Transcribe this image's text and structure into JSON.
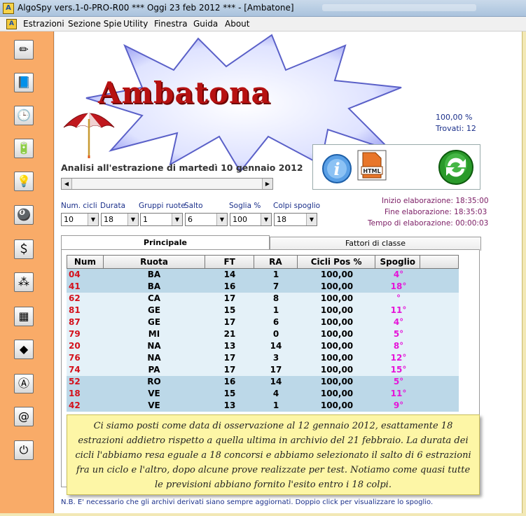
{
  "window": {
    "title": "AlgoSpy vers.1-0-PRO-R00  ***  Oggi 23 feb 2012  ***   - [Ambatone]"
  },
  "menu": [
    "Estrazioni",
    "Sezione Spie",
    "Utility",
    "Finestra",
    "Guida",
    "About"
  ],
  "sidebar_icons": [
    "pencil-icon",
    "book-icon",
    "clock-icon",
    "battery-icon",
    "bulb-icon",
    "lottery-icon",
    "dollar-icon",
    "molecule-icon",
    "calendar-icon",
    "diamond-icon",
    "letter-a-icon",
    "address-book-icon",
    "power-icon"
  ],
  "banner": {
    "title": "Ambatona"
  },
  "stats": {
    "percent": "100,00 %",
    "trovati": "Trovati: 12"
  },
  "analisi": "Analisi all'estrazione di martedì 10 gennaio 2012",
  "params": {
    "labels": [
      "Num. cicli",
      "Durata",
      "Gruppi ruote",
      "Salto",
      "Soglia %",
      "Colpi spoglio"
    ],
    "values": [
      "10",
      "18",
      "1",
      "6",
      "100",
      "18"
    ]
  },
  "elaborazione": {
    "inizio": "Inizio elaborazione: 18:35:00",
    "fine": "Fine elaborazione: 18:35:03",
    "tempo": "Tempo di elaborazione: 00:00:03"
  },
  "tabs": [
    "Principale",
    "Fattori di classe"
  ],
  "table": {
    "headers": [
      "Num",
      "Ruota",
      "FT",
      "RA",
      "Cicli Pos %",
      "Spoglio"
    ],
    "rows": [
      [
        "04",
        "BA",
        "14",
        "1",
        "100,00",
        "4°"
      ],
      [
        "41",
        "BA",
        "16",
        "7",
        "100,00",
        "18°"
      ],
      [
        "62",
        "CA",
        "17",
        "8",
        "100,00",
        "°"
      ],
      [
        "81",
        "GE",
        "15",
        "1",
        "100,00",
        "11°"
      ],
      [
        "87",
        "GE",
        "17",
        "6",
        "100,00",
        "4°"
      ],
      [
        "79",
        "MI",
        "21",
        "0",
        "100,00",
        "5°"
      ],
      [
        "20",
        "NA",
        "13",
        "14",
        "100,00",
        "8°"
      ],
      [
        "76",
        "NA",
        "17",
        "3",
        "100,00",
        "12°"
      ],
      [
        "74",
        "PA",
        "17",
        "17",
        "100,00",
        "15°"
      ],
      [
        "52",
        "RO",
        "16",
        "14",
        "100,00",
        "5°"
      ],
      [
        "18",
        "VE",
        "15",
        "4",
        "100,00",
        "11°"
      ],
      [
        "42",
        "VE",
        "13",
        "1",
        "100,00",
        "9°"
      ]
    ]
  },
  "note": "Ci siamo posti come data di osservazione al 12 gennaio 2012, esattamente 18 estrazioni addietro rispetto a quella ultima in archivio del 21 febbraio. La durata dei cicli l'abbiamo resa eguale a 18 concorsi e abbiamo selezionato il salto di 6 estrazioni fra un ciclo e l'altro, dopo alcune prove realizzate per test. Notiamo come quasi tutte le previsioni abbiano fornito l'esito entro i 18 colpi.",
  "footer": "N.B. E' necessario che gli archivi derivati siano sempre aggiornati. Doppio click per visualizzare lo spoglio.",
  "colors": {
    "num": "#d4111b",
    "spoglio": "#e514d8",
    "blue_row": "#bcd8e8",
    "light_row": "#e4f1f8"
  }
}
